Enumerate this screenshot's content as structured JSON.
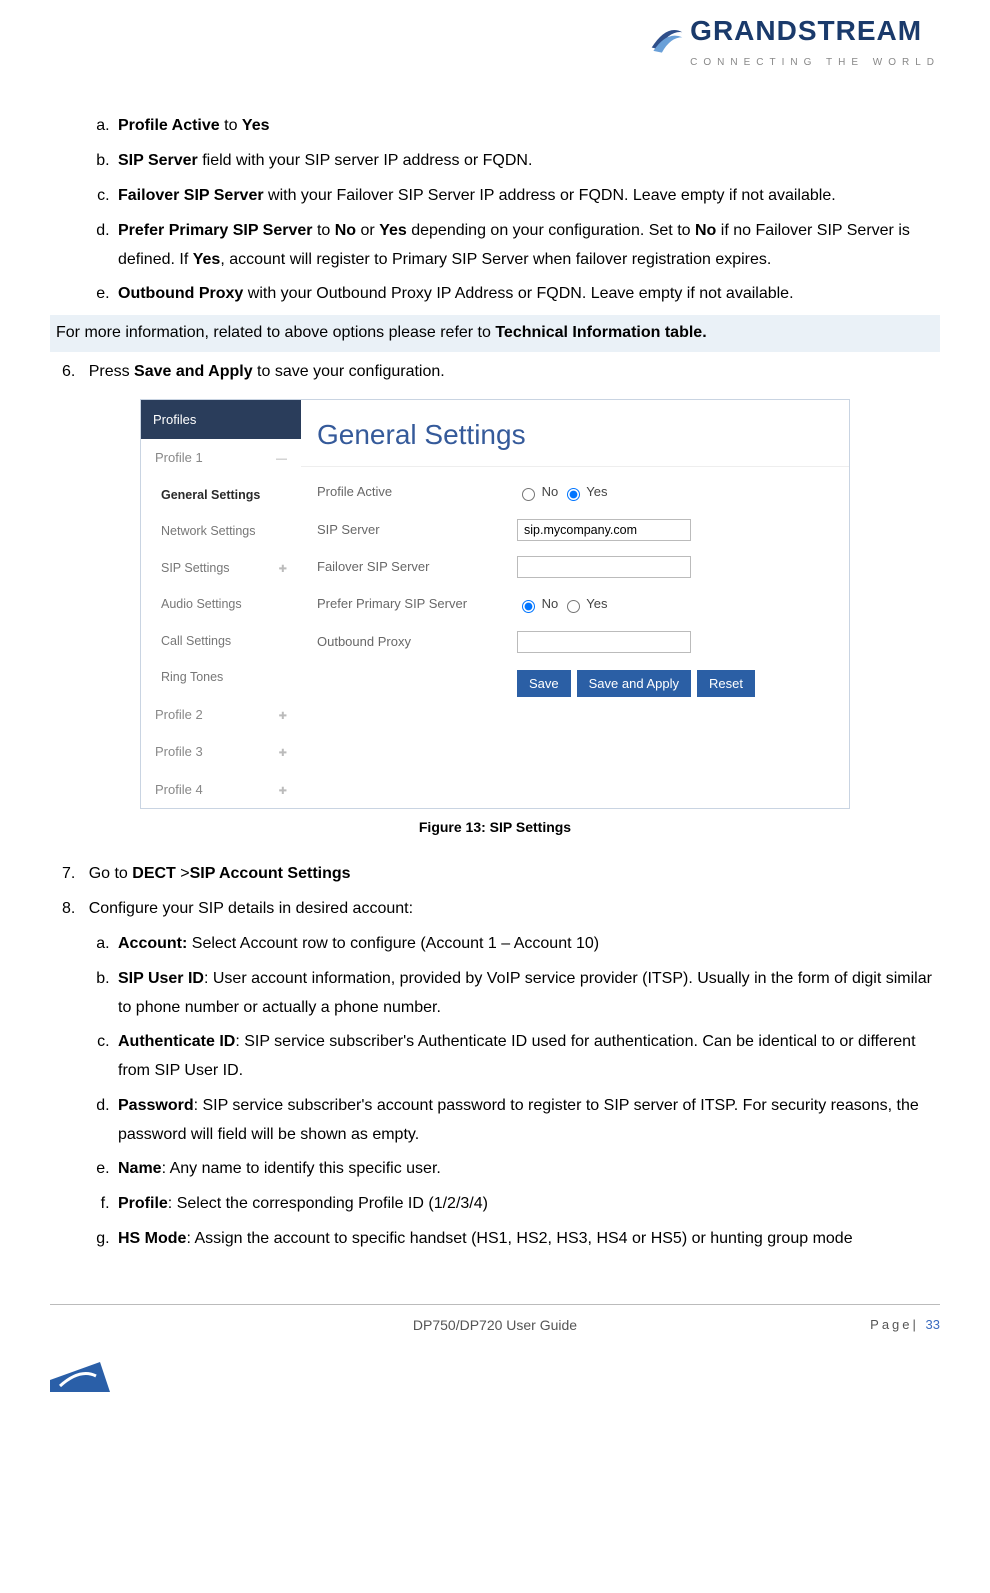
{
  "logo": {
    "name": "GRANDSTREAM",
    "tag": "CONNECTING THE WORLD"
  },
  "list_a": {
    "a": {
      "bold1": "Profile Active",
      "mid": " to ",
      "bold2": "Yes"
    },
    "b": {
      "bold": "SIP Server",
      "rest": " field with your SIP server IP address or FQDN."
    },
    "c": {
      "bold": "Failover SIP Server",
      "rest": " with your Failover SIP Server IP address or FQDN. Leave empty if not available."
    },
    "d": {
      "bold": "Prefer Primary SIP Server",
      "t1": " to ",
      "b2": "No",
      "t2": " or ",
      "b3": "Yes",
      "t3": " depending on your configuration. Set to ",
      "b4": "No",
      "t4": " if no Failover SIP Server is defined. If ",
      "b5": "Yes",
      "t5": ", account will register to Primary SIP Server when failover registration expires."
    },
    "e": {
      "bold": "Outbound Proxy",
      "rest": " with your Outbound Proxy IP Address or FQDN. Leave empty if not available."
    }
  },
  "note": {
    "pre": "For more information, related to above options please refer to ",
    "bold": "Technical Information table."
  },
  "step6": {
    "num": "6.",
    "pre": "Press ",
    "bold": "Save and Apply",
    "post": " to save your configuration."
  },
  "figure": {
    "sidebar_head": "Profiles",
    "item1": "Profile 1",
    "sub": {
      "general": "General Settings",
      "network": "Network Settings",
      "sip": "SIP Settings",
      "audio": "Audio Settings",
      "call": "Call Settings",
      "ring": "Ring Tones"
    },
    "p2": "Profile 2",
    "p3": "Profile 3",
    "p4": "Profile 4",
    "title": "General Settings",
    "rows": {
      "profile_active": "Profile Active",
      "sip_server": "SIP Server",
      "failover": "Failover SIP Server",
      "prefer": "Prefer Primary SIP Server",
      "outbound": "Outbound Proxy"
    },
    "radio": {
      "no": "No",
      "yes": "Yes"
    },
    "sip_value": "sip.mycompany.com",
    "btn_save": "Save",
    "btn_save_apply": "Save and Apply",
    "btn_reset": "Reset",
    "caption": "Figure 13: SIP Settings"
  },
  "step7": {
    "num": "7.",
    "pre": "Go to ",
    "b1": "DECT",
    "mid": " >",
    "b2": "SIP Account Settings"
  },
  "step8": {
    "num": "8.",
    "text": "Configure your SIP details in desired account:"
  },
  "list_b": {
    "a": {
      "bold": "Account:",
      "rest": " Select Account row to configure (Account 1 – Account 10)"
    },
    "b": {
      "bold": "SIP User ID",
      "rest": ": User account information, provided by VoIP service provider (ITSP). Usually in the form of digit similar to phone number or actually a phone number."
    },
    "c": {
      "bold": "Authenticate ID",
      "rest": ": SIP service subscriber's Authenticate ID used for authentication. Can be identical to or different from SIP User ID."
    },
    "d": {
      "bold": "Password",
      "rest": ": SIP service subscriber's account password to register to SIP server of ITSP. For security reasons, the password will field will be shown as empty."
    },
    "e": {
      "bold": "Name",
      "rest": ": Any name to identify this specific user."
    },
    "f": {
      "bold": "Profile",
      "rest": ": Select the corresponding Profile ID (1/2/3/4)"
    },
    "g": {
      "bold": "HS Mode",
      "rest": ": Assign the account to specific handset (HS1, HS2, HS3, HS4 or HS5) or hunting group mode"
    }
  },
  "footer": {
    "center": "DP750/DP720 User Guide",
    "page_label": "Page|",
    "page_num": "33"
  }
}
